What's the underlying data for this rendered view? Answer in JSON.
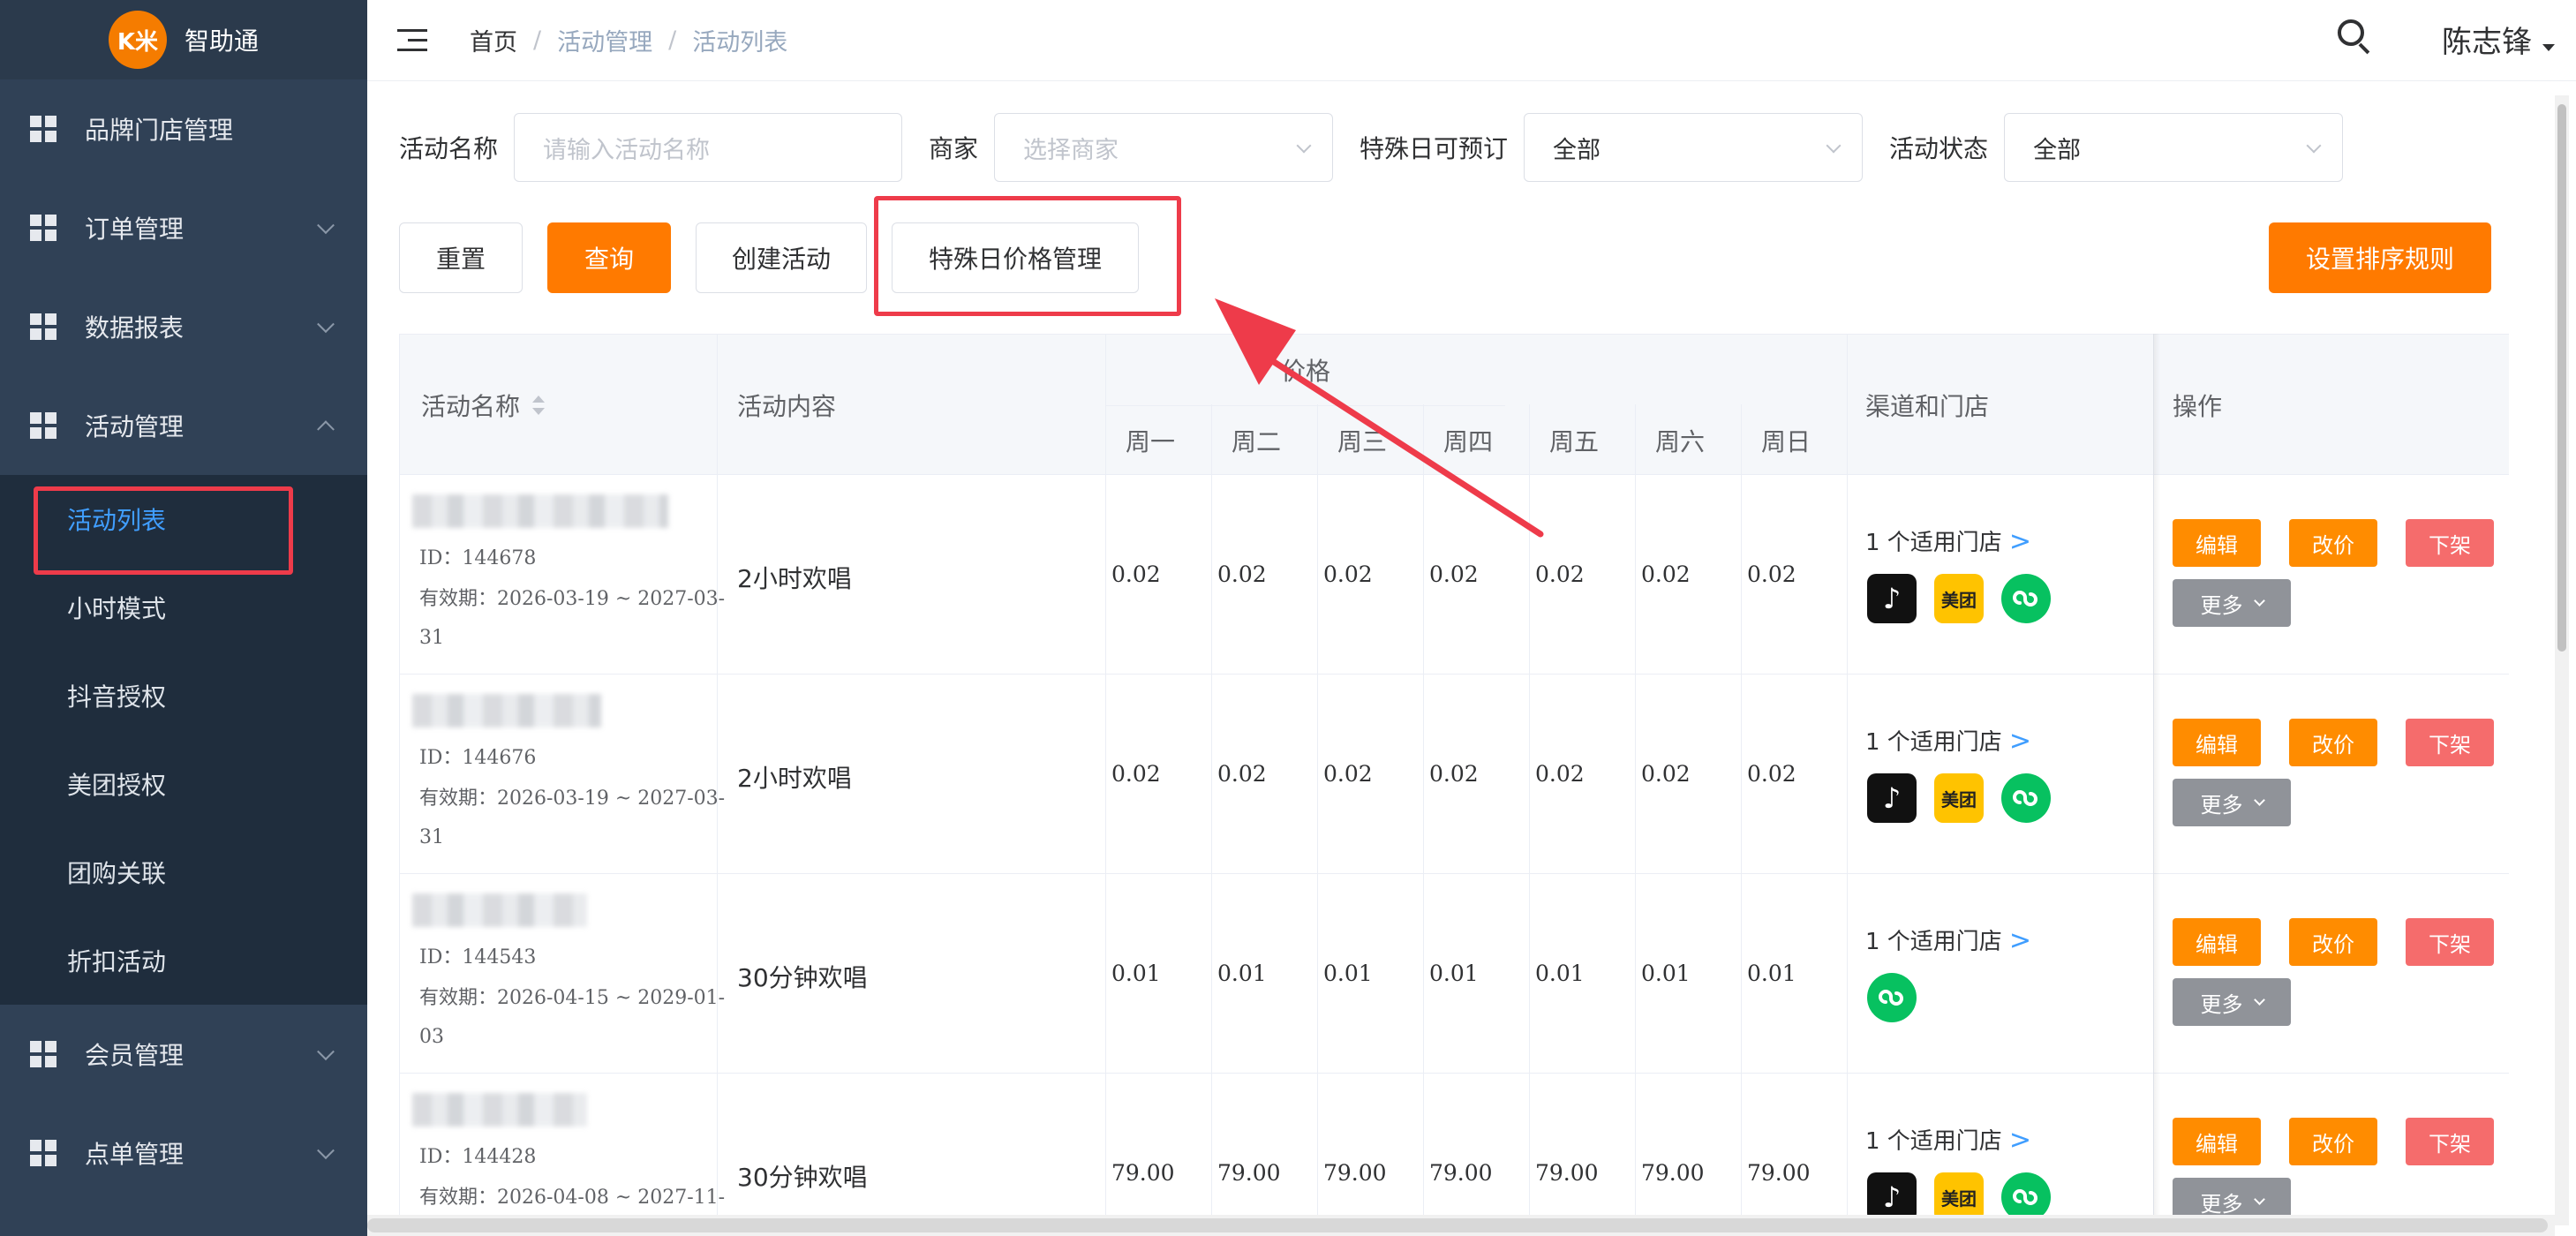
{
  "logo": {
    "mark": "K米",
    "name": "智助通"
  },
  "sidebar": {
    "items": [
      {
        "label": "品牌门店管理"
      },
      {
        "label": "订单管理"
      },
      {
        "label": "数据报表"
      },
      {
        "label": "活动管理"
      },
      {
        "label": "会员管理"
      },
      {
        "label": "点单管理"
      }
    ],
    "submenu": [
      {
        "label": "活动列表"
      },
      {
        "label": "小时模式"
      },
      {
        "label": "抖音授权"
      },
      {
        "label": "美团授权"
      },
      {
        "label": "团购关联"
      },
      {
        "label": "折扣活动"
      }
    ]
  },
  "header": {
    "breadcrumb": [
      "首页",
      "活动管理",
      "活动列表"
    ],
    "separator": "/",
    "username": "陈志锋"
  },
  "filters": {
    "name_label": "活动名称",
    "name_placeholder": "请输入活动名称",
    "merchant_label": "商家",
    "merchant_placeholder": "选择商家",
    "special_label": "特殊日可预订",
    "special_value": "全部",
    "status_label": "活动状态",
    "status_value": "全部"
  },
  "buttons": {
    "reset": "重置",
    "query": "查询",
    "create": "创建活动",
    "special_price": "特殊日价格管理",
    "sort_rule": "设置排序规则"
  },
  "table": {
    "headers": {
      "name": "活动名称",
      "content": "活动内容",
      "price": "价格",
      "days": [
        "周一",
        "周二",
        "周三",
        "周四",
        "周五",
        "周六",
        "周日"
      ],
      "channels": "渠道和门店",
      "actions": "操作"
    },
    "rows": [
      {
        "id": "ID：144678",
        "validity_a": "有效期：2026-03-19 ~ 2027-03-",
        "validity_b": "31",
        "content": "2小时欢唱",
        "prices": [
          "0.02",
          "0.02",
          "0.02",
          "0.02",
          "0.02",
          "0.02",
          "0.02"
        ],
        "stores": "1 个适用门店",
        "channels": [
          "douyin",
          "meituan",
          "miniprogram"
        ]
      },
      {
        "id": "ID：144676",
        "validity_a": "有效期：2026-03-19 ~ 2027-03-",
        "validity_b": "31",
        "content": "2小时欢唱",
        "prices": [
          "0.02",
          "0.02",
          "0.02",
          "0.02",
          "0.02",
          "0.02",
          "0.02"
        ],
        "stores": "1 个适用门店",
        "channels": [
          "douyin",
          "meituan",
          "miniprogram"
        ]
      },
      {
        "id": "ID：144543",
        "validity_a": "有效期：2026-04-15 ~ 2029-01-",
        "validity_b": "03",
        "content": "30分钟欢唱",
        "prices": [
          "0.01",
          "0.01",
          "0.01",
          "0.01",
          "0.01",
          "0.01",
          "0.01"
        ],
        "stores": "1 个适用门店",
        "channels": [
          "miniprogram"
        ]
      },
      {
        "id": "ID：144428",
        "validity_a": "有效期：2026-04-08 ~ 2027-11-",
        "validity_b": "",
        "content": "30分钟欢唱",
        "prices": [
          "79.00",
          "79.00",
          "79.00",
          "79.00",
          "79.00",
          "79.00",
          "79.00"
        ],
        "stores": "1 个适用门店",
        "channels": [
          "douyin",
          "meituan",
          "miniprogram"
        ]
      }
    ],
    "actions": {
      "edit": "编辑",
      "reprice": "改价",
      "off": "下架",
      "more": "更多"
    },
    "store_arrow": ">",
    "meituan_text": "美团"
  },
  "colors": {
    "accent": "#ff7a00",
    "danger": "#f56c6c",
    "link": "#409eff",
    "sidebar": "#304156",
    "highlight": "#ee3b4a"
  }
}
